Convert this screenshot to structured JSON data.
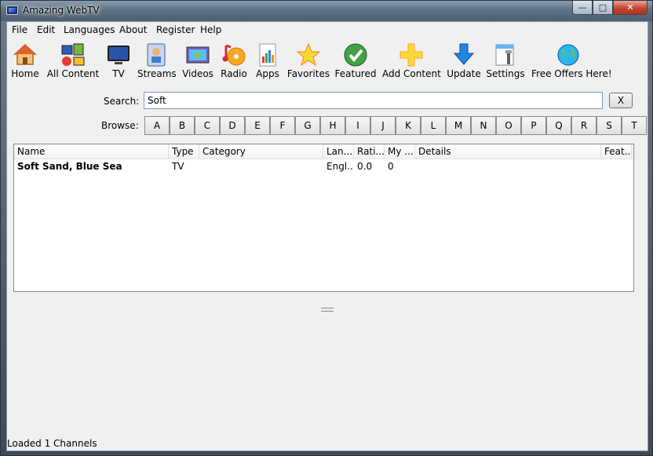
{
  "window": {
    "title": "Amazing WebTV"
  },
  "menu": [
    "File",
    "Edit",
    "Languages",
    "About",
    "Register",
    "Help"
  ],
  "toolbar": [
    {
      "label": "Home",
      "icon": "home-icon"
    },
    {
      "label": "All Content",
      "icon": "all-content-icon"
    },
    {
      "label": "TV",
      "icon": "tv-icon"
    },
    {
      "label": "Streams",
      "icon": "streams-icon"
    },
    {
      "label": "Videos",
      "icon": "videos-icon"
    },
    {
      "label": "Radio",
      "icon": "radio-icon"
    },
    {
      "label": "Apps",
      "icon": "apps-icon"
    },
    {
      "label": "Favorites",
      "icon": "star-icon"
    },
    {
      "label": "Featured",
      "icon": "checkmark-icon"
    },
    {
      "label": "Add Content",
      "icon": "plus-icon"
    },
    {
      "label": "Update",
      "icon": "download-arrow-icon"
    },
    {
      "label": "Settings",
      "icon": "settings-icon"
    },
    {
      "label": "Free Offers Here!",
      "icon": "globe-icon"
    }
  ],
  "search": {
    "label": "Search:",
    "value": "Soft",
    "clear_label": "X"
  },
  "browse": {
    "label": "Browse:",
    "letters": [
      "A",
      "B",
      "C",
      "D",
      "E",
      "F",
      "G",
      "H",
      "I",
      "J",
      "K",
      "L",
      "M",
      "N",
      "O",
      "P",
      "Q",
      "R",
      "S",
      "T"
    ]
  },
  "table": {
    "columns": [
      "Name",
      "Type",
      "Category",
      "Lan...",
      "Rati...",
      "My ...",
      "Details",
      "Feat..."
    ],
    "rows": [
      [
        "Soft Sand, Blue Sea",
        "TV",
        "",
        "Engl...",
        "0.0",
        "0",
        "",
        ""
      ]
    ]
  },
  "status": "Loaded 1 Channels"
}
